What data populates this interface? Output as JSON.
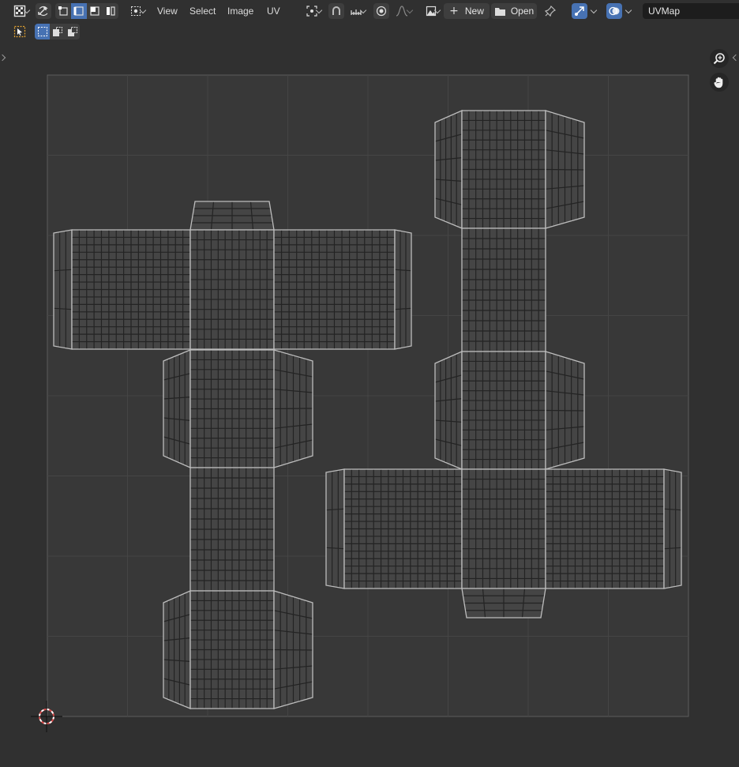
{
  "header": {
    "menus": [
      "View",
      "Select",
      "Image",
      "UV"
    ],
    "new_label": "New",
    "open_label": "Open",
    "uv_map_name": "UVMap"
  },
  "icons": {
    "editor_type": "uv-editor-icon",
    "sync": "uv-sync-selection-icon",
    "select_modes": [
      "vertex-select-icon",
      "edge-select-icon",
      "face-select-icon",
      "island-select-icon"
    ],
    "pivot": "pivot-point-icon",
    "snap": "snap-icon",
    "proportional": "proportional-editing-icon",
    "image": "image-browse-icon",
    "pin": "pin-icon",
    "gizmo": "gizmo-icon",
    "overlay": "overlay-icon",
    "tool": "select-box-tool-icon",
    "zoom": "zoom-icon",
    "pan": "hand-pan-icon",
    "cursor": "2d-cursor-icon"
  },
  "colors": {
    "background": "#303030",
    "grid_bg": "#383838",
    "grid_line": "#454545",
    "uv_fill": "#454545",
    "uv_wire": "#232323",
    "uv_edge": "#bdbdbd",
    "accent": "#4772b3"
  }
}
